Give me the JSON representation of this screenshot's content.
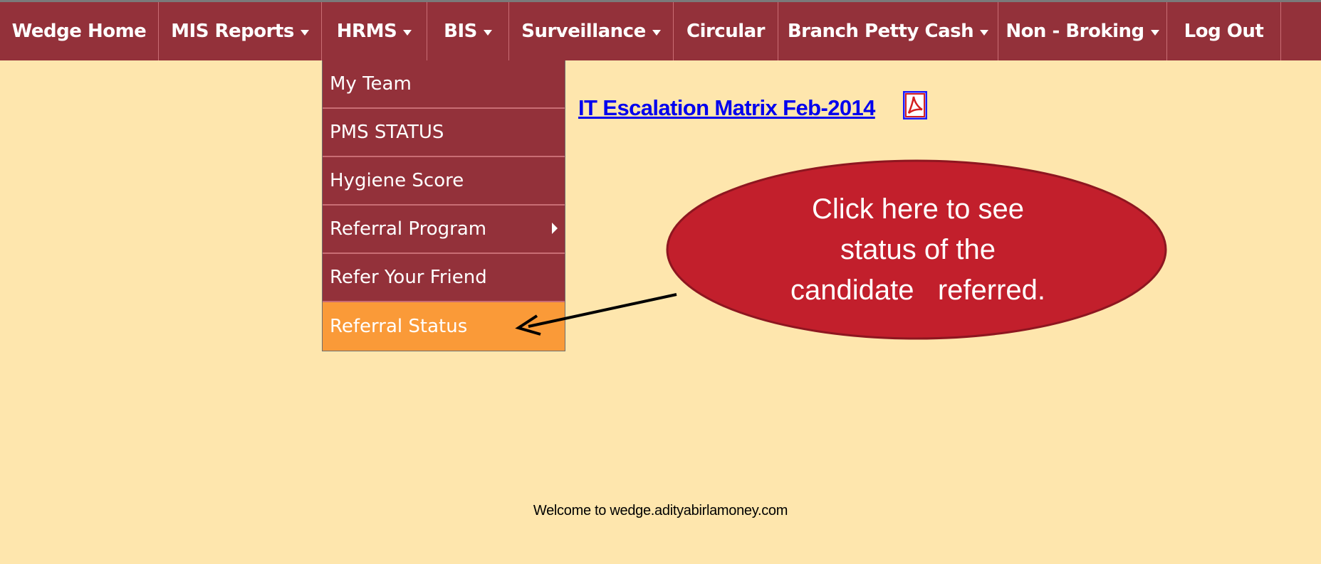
{
  "nav": {
    "items": [
      {
        "label": "Wedge Home",
        "has_dropdown": false
      },
      {
        "label": "MIS Reports",
        "has_dropdown": true
      },
      {
        "label": "HRMS",
        "has_dropdown": true
      },
      {
        "label": "BIS",
        "has_dropdown": true
      },
      {
        "label": "Surveillance",
        "has_dropdown": true
      },
      {
        "label": "Circular",
        "has_dropdown": false
      },
      {
        "label": "Branch Petty Cash",
        "has_dropdown": true
      },
      {
        "label": "Non - Broking",
        "has_dropdown": true
      },
      {
        "label": "Log Out",
        "has_dropdown": false
      }
    ]
  },
  "hrms_menu": {
    "items": [
      {
        "label": "My Team"
      },
      {
        "label": "PMS STATUS"
      },
      {
        "label": "Hygiene Score"
      },
      {
        "label": "Referral Program",
        "has_submenu": true
      },
      {
        "label": "Refer Your Friend"
      },
      {
        "label": "Referral Status",
        "highlighted": true
      }
    ]
  },
  "content": {
    "doc_link": "IT Escalation Matrix Feb-2014",
    "doc_icon": "pdf-icon"
  },
  "callout": {
    "text": "Click here to see\nstatus of the\ncandidate   referred."
  },
  "footer": {
    "welcome": "Welcome to wedge.adityabirlamoney.com"
  },
  "colors": {
    "nav_background": "#93313a",
    "page_background": "#fee6ad",
    "menu_highlight": "#fa9a38",
    "callout_fill": "#c21f2c",
    "link": "#0000ee"
  }
}
